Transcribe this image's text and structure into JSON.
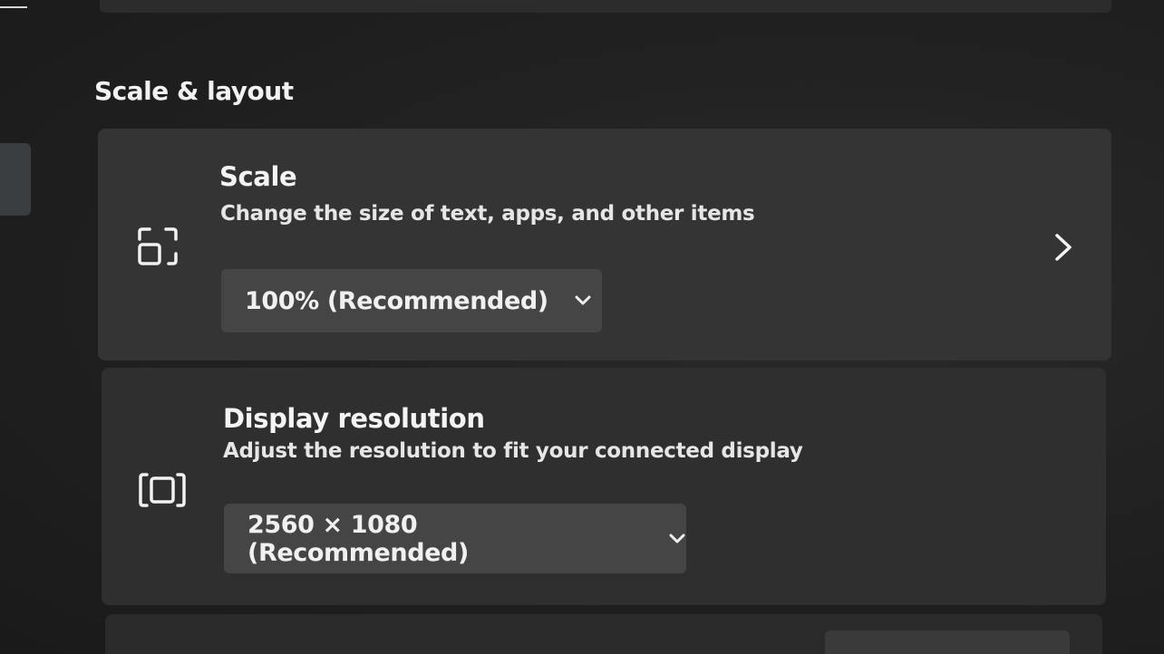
{
  "section": {
    "title": "Scale & layout"
  },
  "scale": {
    "icon": "scale-icon",
    "title": "Scale",
    "description": "Change the size of text, apps, and other items",
    "selected": "100% (Recommended)",
    "expand_icon": "chevron-right-icon"
  },
  "resolution": {
    "icon": "display-resolution-icon",
    "title": "Display resolution",
    "description": "Adjust the resolution to fit your connected display",
    "selected": "2560 × 1080 (Recommended)"
  },
  "colors": {
    "background": "#1f1f1f",
    "card": "#323232",
    "dropdown": "#454545",
    "text": "#f4f4f4"
  }
}
